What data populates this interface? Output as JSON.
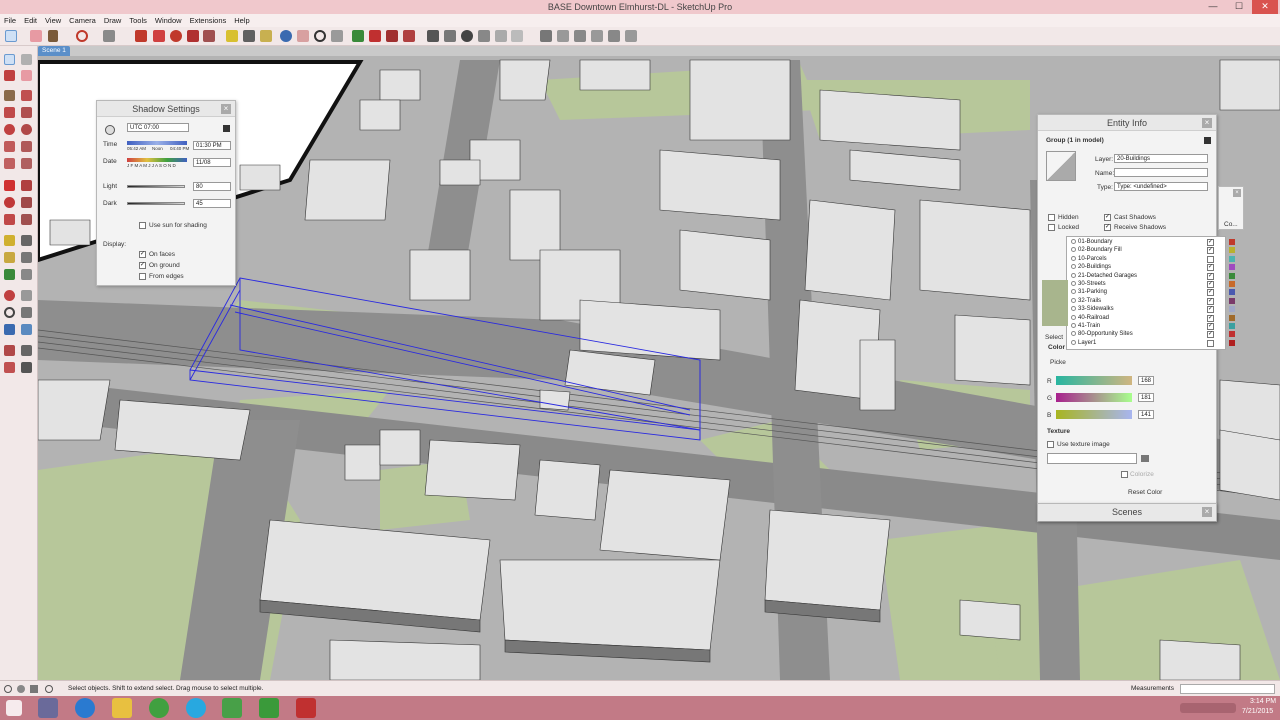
{
  "window": {
    "title": "BASE Downtown Elmhurst-DL - SketchUp Pro",
    "minimize": "—",
    "maximize": "☐",
    "close": "✕"
  },
  "menu": [
    "File",
    "Edit",
    "View",
    "Camera",
    "Draw",
    "Tools",
    "Window",
    "Extensions",
    "Help"
  ],
  "scene_tab": "Scene 1",
  "shadow_settings": {
    "title": "Shadow Settings",
    "close": "×",
    "timezone": "UTC 07:00",
    "time_label": "Time",
    "time_start": "05:42 AM",
    "time_noon": "Noon",
    "time_end": "04:40 PM",
    "time_value": "01:30 PM",
    "date_label": "Date",
    "months": "J F M A M J J A S O N D",
    "date_value": "11/08",
    "light_label": "Light",
    "light_value": "80",
    "dark_label": "Dark",
    "dark_value": "45",
    "use_sun_label": "Use sun for shading",
    "display_label": "Display:",
    "on_faces_label": "On faces",
    "on_ground_label": "On ground",
    "from_edges_label": "From edges"
  },
  "entity_info": {
    "title": "Entity Info",
    "close": "×",
    "group_label": "Group (1 in model)",
    "layer_label": "Layer:",
    "layer_value": "20-Buildings",
    "name_label": "Name:",
    "type_label": "Type:",
    "type_value": "Type: <undefined>",
    "hidden_label": "Hidden",
    "locked_label": "Locked",
    "cast_shadows_label": "Cast Shadows",
    "receive_shadows_label": "Receive Shadows"
  },
  "layers": [
    {
      "name": "01-Boundary",
      "checked": true,
      "color": "#c0392b"
    },
    {
      "name": "02-Boundary Fill",
      "checked": true,
      "color": "#b9b12e"
    },
    {
      "name": "10-Parcels",
      "checked": false,
      "color": "#4cb4b0"
    },
    {
      "name": "20-Buildings",
      "checked": true,
      "color": "#a04ac0"
    },
    {
      "name": "21-Detached Garages",
      "checked": true,
      "color": "#3a8a3a"
    },
    {
      "name": "30-Streets",
      "checked": true,
      "color": "#c86a2a"
    },
    {
      "name": "31-Parking",
      "checked": true,
      "color": "#4a5ab0"
    },
    {
      "name": "32-Trails",
      "checked": true,
      "color": "#7a3a6a"
    },
    {
      "name": "33-Sidewalks",
      "checked": true,
      "color": "#a0a8c8"
    },
    {
      "name": "40-Railroad",
      "checked": true,
      "color": "#a06a2a"
    },
    {
      "name": "41-Train",
      "checked": true,
      "color": "#3aa0a0"
    },
    {
      "name": "80-Opportunity Sites",
      "checked": true,
      "color": "#c03030"
    },
    {
      "name": "Layer1",
      "checked": false,
      "color": "#b02020"
    }
  ],
  "materials": {
    "select_label": "Select",
    "color_label": "Color",
    "picker_label": "Picke",
    "r_label": "R",
    "r_value": "168",
    "g_label": "G",
    "g_value": "181",
    "b_label": "B",
    "b_value": "141",
    "swatch_color": "#a8b58d",
    "texture_label": "Texture",
    "use_texture_label": "Use texture image",
    "colorize_label": "Colorize",
    "reset_label": "Reset Color",
    "co_label": "Co..."
  },
  "scenes": {
    "title": "Scenes",
    "close": "×"
  },
  "statusbar": {
    "hint": "Select objects. Shift to extend select. Drag mouse to select multiple.",
    "measurements": "Measurements"
  },
  "taskbar": {
    "time": "3:14 PM",
    "date": "7/21/2015"
  },
  "colors": {
    "titlebar": "#f0c8cc",
    "taskbar": "#c27a86",
    "selection": "#2a2ae0",
    "ground": "#b3b3b3",
    "street": "#8e8e8e",
    "grass": "#b7c79a",
    "building": "#e3e3e3"
  }
}
